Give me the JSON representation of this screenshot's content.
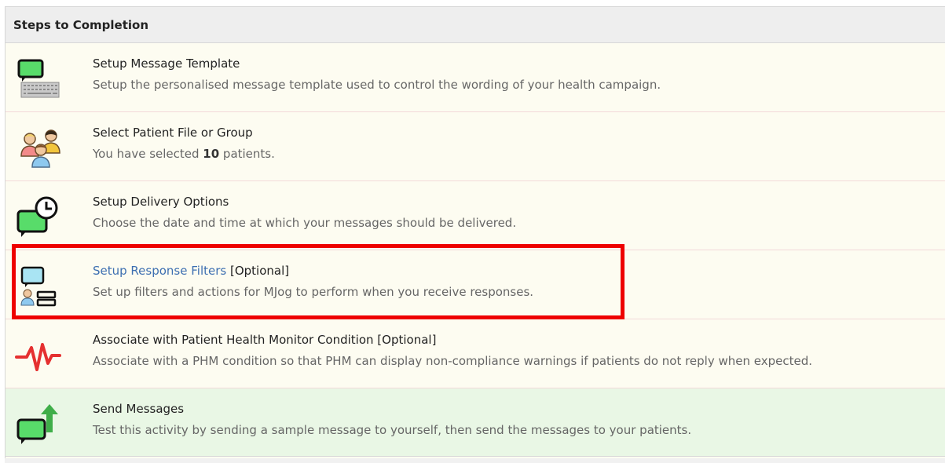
{
  "header": {
    "title": "Steps to Completion"
  },
  "steps": [
    {
      "title": "Setup Message Template",
      "description": "Setup the personalised message template used to control the wording of your health campaign.",
      "icon": "message-template-icon"
    },
    {
      "title": "Select Patient File or Group",
      "description_prefix": "You have selected ",
      "description_count": "10",
      "description_suffix": " patients.",
      "icon": "patients-group-icon"
    },
    {
      "title": "Setup Delivery Options",
      "description": "Choose the date and time at which your messages should be delivered.",
      "icon": "delivery-clock-icon"
    },
    {
      "title_link": "Setup Response Filters",
      "title_suffix": " [Optional]",
      "description": "Set up filters and actions for MJog to perform when you receive responses.",
      "icon": "response-filters-icon"
    },
    {
      "title": "Associate with Patient Health Monitor Condition [Optional]",
      "description": "Associate with a PHM condition so that PHM can display non-compliance warnings if patients do not reply when expected.",
      "icon": "heartbeat-icon"
    },
    {
      "title": "Send Messages",
      "description": "Test this activity by sending a sample message to yourself, then send the messages to your patients.",
      "icon": "send-message-icon"
    }
  ],
  "colors": {
    "highlight": "#ee0000",
    "row_bg": "#fdfcf1",
    "send_row_bg": "#e9f7e5",
    "link": "#3d6fb1",
    "icon_green": "#58dc6a"
  }
}
